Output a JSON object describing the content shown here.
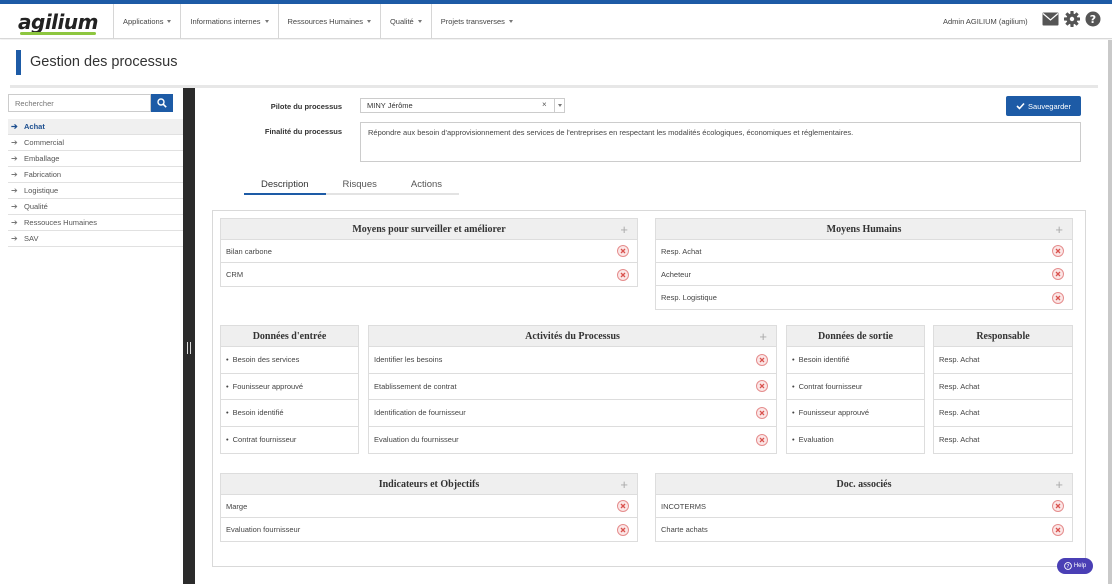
{
  "app": {
    "logo_text": "agilium"
  },
  "nav": {
    "items": [
      {
        "label": "Applications"
      },
      {
        "label": "Informations internes"
      },
      {
        "label": "Ressources Humaines"
      },
      {
        "label": "Qualité"
      },
      {
        "label": "Projets transverses"
      }
    ],
    "user": "Admin AGILIUM (agilium)",
    "icons": [
      "envelope-icon",
      "gear-icon",
      "help-icon"
    ]
  },
  "page": {
    "title": "Gestion des processus"
  },
  "sidebar": {
    "search_placeholder": "Rechercher",
    "items": [
      {
        "label": "Achat",
        "active": true
      },
      {
        "label": "Commercial"
      },
      {
        "label": "Emballage"
      },
      {
        "label": "Fabrication"
      },
      {
        "label": "Logistique"
      },
      {
        "label": "Qualité"
      },
      {
        "label": "Ressouces Humaines"
      },
      {
        "label": "SAV"
      }
    ]
  },
  "form": {
    "pilote_label": "Pilote du processus",
    "pilote_value": "MINY Jérôme",
    "finalite_label": "Finalité du processus",
    "finalite_value": "Répondre aux besoin d'approvisionnement des services de l'entreprises en respectant les modalités écologiques, économiques et réglementaires.",
    "save_label": "Sauvegarder"
  },
  "tabs": [
    {
      "label": "Description",
      "active": true
    },
    {
      "label": "Risques"
    },
    {
      "label": "Actions"
    }
  ],
  "panels": {
    "surveiller": {
      "title": "Moyens pour surveiller et améliorer",
      "rows": [
        "Bilan carbone",
        "CRM"
      ]
    },
    "humains": {
      "title": "Moyens Humains",
      "rows": [
        "Resp. Achat",
        "Acheteur",
        "Resp. Logistique"
      ]
    },
    "entree": {
      "title": "Données d'entrée",
      "rows": [
        "Besoin des services",
        "Founisseur approuvé",
        "Besoin identifié",
        "Contrat fournisseur"
      ]
    },
    "activites": {
      "title": "Activités du Processus",
      "rows": [
        "Identifier les besoins",
        "Etablissement de contrat",
        "Identification de fournisseur",
        "Evaluation du fournisseur"
      ]
    },
    "sortie": {
      "title": "Données de sortie",
      "rows": [
        "Besoin identifié",
        "Contrat fournisseur",
        "Founisseur approuvé",
        "Evaluation"
      ]
    },
    "responsable": {
      "title": "Responsable",
      "rows": [
        "Resp. Achat",
        "Resp. Achat",
        "Resp. Achat",
        "Resp. Achat"
      ]
    },
    "indicateurs": {
      "title": "Indicateurs et Objectifs",
      "rows": [
        "Marge",
        "Evaluation fournisseur"
      ]
    },
    "docs": {
      "title": "Doc. associés",
      "rows": [
        "INCOTERMS",
        "Charte achats"
      ]
    }
  },
  "help": {
    "label": "Help"
  }
}
